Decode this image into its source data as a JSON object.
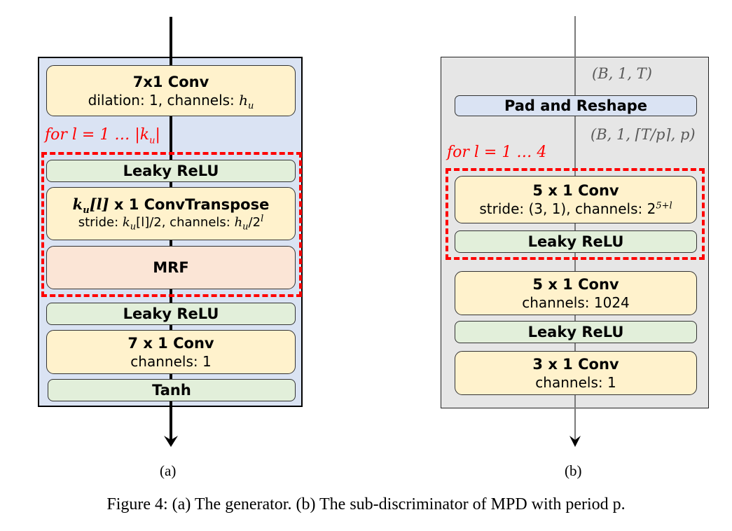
{
  "figure": {
    "caption": "Figure 4: (a) The generator. (b) The sub-discriminator of MPD with period p.",
    "colors": {
      "generator_bg": "#dae3f3",
      "discriminator_bg": "#e6e6e6",
      "conv_block": "#fff2cc",
      "activation_block": "#e2efda",
      "mrf_block": "#fbe5d6",
      "reshape_block": "#dae3f3",
      "loop_highlight": "#ff0000"
    }
  },
  "generator": {
    "label": "(a)",
    "loop_label": {
      "prefix": "for  l = 1 … |k",
      "sub": "u",
      "suffix": "|"
    },
    "blocks": [
      {
        "title": "7x1 Conv",
        "sub_prefix": "dilation: 1, channels: ",
        "sub_math": "h",
        "sub_sub": "u"
      },
      {
        "title": "Leaky ReLU"
      },
      {
        "title_math": "k",
        "title_math_sub": "u",
        "title_math_idx": "[l]",
        "title_rest": " x 1  ConvTranspose",
        "sub_prefix": "stride: ",
        "sub_math1": "k",
        "sub_sub1": "u",
        "sub_mid1": "[l]/2, channels: ",
        "sub_math2": "h",
        "sub_sub2": "u",
        "sub_mid2": "/2",
        "sub_sup": "l"
      },
      {
        "title": "MRF"
      },
      {
        "title": "Leaky ReLU"
      },
      {
        "title": "7 x 1  Conv",
        "sub": "channels: 1"
      },
      {
        "title": "Tanh"
      }
    ]
  },
  "discriminator": {
    "label": "(b)",
    "input_shape": "(B, 1, T)",
    "reshaped_shape": "(B, 1, ⌈T/p⌉, p)",
    "loop_label": "for  l = 1 … 4",
    "blocks": [
      {
        "title": "Pad and Reshape"
      },
      {
        "title": "5 x 1  Conv",
        "sub_prefix": "stride: (3, 1), channels: 2",
        "sub_sup": "5+l"
      },
      {
        "title": "Leaky ReLU"
      },
      {
        "title": "5 x 1  Conv",
        "sub": "channels: 1024"
      },
      {
        "title": "Leaky ReLU"
      },
      {
        "title": "3 x 1  Conv",
        "sub": "channels: 1"
      }
    ]
  }
}
